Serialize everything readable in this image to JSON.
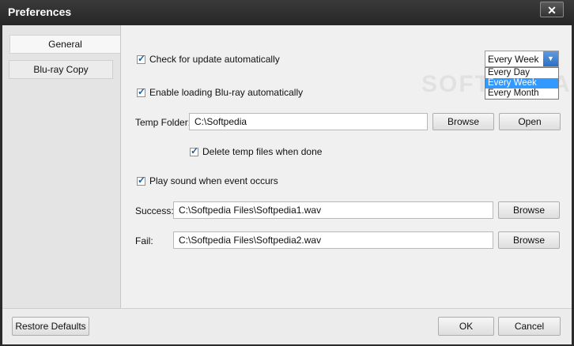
{
  "window": {
    "title": "Preferences",
    "close_label": "✕"
  },
  "sidebar": {
    "items": [
      {
        "label": "General"
      },
      {
        "label": "Blu-ray Copy"
      }
    ]
  },
  "general": {
    "check_update": {
      "label": "Check for update automatically",
      "checked": true
    },
    "frequency": {
      "selected": "Every Week",
      "options": [
        "Every Day",
        "Every Week",
        "Every Month"
      ]
    },
    "enable_loading": {
      "label": "Enable loading Blu-ray automatically",
      "checked": true
    },
    "temp_folder": {
      "label": "Temp Folder:",
      "value": "C:\\Softpedia",
      "browse_label": "Browse",
      "open_label": "Open"
    },
    "delete_temp": {
      "label": "Delete temp files when done",
      "checked": true
    },
    "play_sound": {
      "label": "Play sound when event occurs",
      "checked": true
    },
    "success": {
      "label": "Success:",
      "value": "C:\\Softpedia Files\\Softpedia1.wav",
      "browse_label": "Browse"
    },
    "fail": {
      "label": "Fail:",
      "value": "C:\\Softpedia Files\\Softpedia2.wav",
      "browse_label": "Browse"
    }
  },
  "footer": {
    "restore_label": "Restore Defaults",
    "ok_label": "OK",
    "cancel_label": "Cancel"
  },
  "watermark": "SOFTPEDIA",
  "colors": {
    "accent": "#3399ff",
    "titlebar": "#2b2b2b"
  }
}
